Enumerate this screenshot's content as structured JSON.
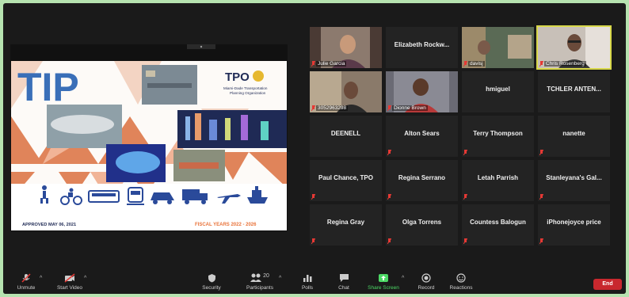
{
  "shared_screen": {
    "tip_title": "TIP",
    "tpo_logo": "TPO",
    "org_name_line1": "Miami-Dade Transportation",
    "org_name_line2": "Planning Organization",
    "approved": "APPROVED MAY 06, 2021",
    "fiscal_years": "FISCAL YEARS 2022 - 2026",
    "transport_icons": [
      "pedestrian-icon",
      "bicycle-icon",
      "bus-icon",
      "train-icon",
      "car-icon",
      "truck-icon",
      "airplane-icon",
      "ship-icon"
    ]
  },
  "participants": [
    {
      "name": "Julie Garcia",
      "video": true,
      "muted": true
    },
    {
      "name": "Elizabeth  Rockw...",
      "video": false,
      "muted": false
    },
    {
      "name": "davisj",
      "video": true,
      "muted": true
    },
    {
      "name": "Chris Rosenberg",
      "video": true,
      "muted": true,
      "active": true
    },
    {
      "name": "3052963298",
      "video": true,
      "muted": true
    },
    {
      "name": "Dionne Brown",
      "video": true,
      "muted": true
    },
    {
      "name": "hmiguel",
      "video": false,
      "muted": false
    },
    {
      "name": "TCHLER  ANTEN...",
      "video": false,
      "muted": false
    },
    {
      "name": "DEENELL",
      "video": false,
      "muted": false
    },
    {
      "name": "Alton Sears",
      "video": false,
      "muted": true
    },
    {
      "name": "Terry Thompson",
      "video": false,
      "muted": true
    },
    {
      "name": "nanette",
      "video": false,
      "muted": true
    },
    {
      "name": "Paul Chance, TPO",
      "video": false,
      "muted": true
    },
    {
      "name": "Regina Serrano",
      "video": false,
      "muted": true
    },
    {
      "name": "Letah Parrish",
      "video": false,
      "muted": true
    },
    {
      "name": "Stanleyana's  Gal...",
      "video": false,
      "muted": true
    },
    {
      "name": "Regina Gray",
      "video": false,
      "muted": true
    },
    {
      "name": "Olga Torrens",
      "video": false,
      "muted": true
    },
    {
      "name": "Countess Balogun",
      "video": false,
      "muted": true
    },
    {
      "name": "iPhonejoyce price",
      "video": false,
      "muted": true
    }
  ],
  "toolbar": {
    "unmute": "Unmute",
    "start_video": "Start Video",
    "security": "Security",
    "participants": "Participants",
    "participants_count": "20",
    "polls": "Polls",
    "chat": "Chat",
    "share_screen": "Share Screen",
    "record": "Record",
    "reactions": "Reactions",
    "end": "End"
  },
  "colors": {
    "share_green": "#4cd965",
    "end_red": "#c8282e",
    "active_speaker": "#d8d84a",
    "tip_blue": "#3a6fb8",
    "triangle_orange": "#e0845a",
    "fiscal_orange": "#e9733a"
  }
}
